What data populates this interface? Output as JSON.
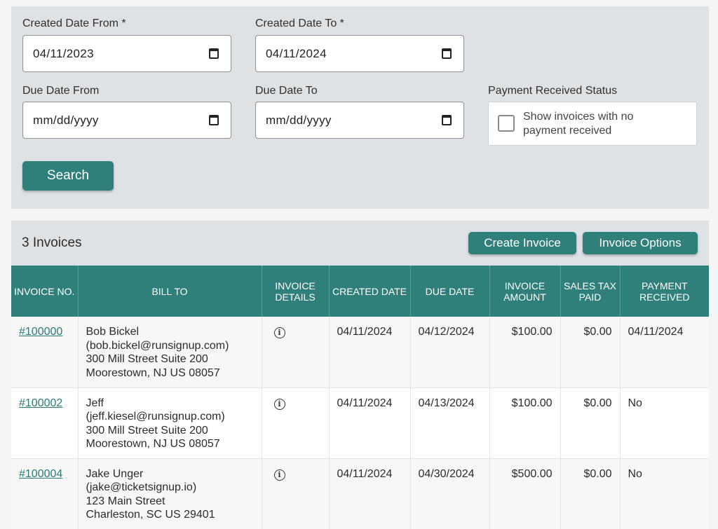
{
  "filters": {
    "created_from_label": "Created Date From *",
    "created_from_value": "04/11/2023",
    "created_to_label": "Created Date To *",
    "created_to_value": "04/11/2024",
    "due_from_label": "Due Date From",
    "due_from_value": "mm/dd/yyyy",
    "due_to_label": "Due Date To",
    "due_to_value": "mm/dd/yyyy",
    "payment_status_label": "Payment Received Status",
    "no_payment_checkbox_label": "Show invoices with no payment received",
    "no_payment_checked": false,
    "search_label": "Search"
  },
  "results": {
    "count_label": "3 Invoices",
    "create_invoice_label": "Create Invoice",
    "invoice_options_label": "Invoice Options",
    "columns": [
      "Invoice No.",
      "Bill To",
      "Invoice Details",
      "Created Date",
      "Due Date",
      "Invoice Amount",
      "Sales Tax Paid",
      "Payment Received"
    ],
    "rows": [
      {
        "invoice_no": "#100000",
        "bill_name": "Bob Bickel",
        "bill_email": "(bob.bickel@runsignup.com)",
        "bill_street": "300 Mill Street Suite 200",
        "bill_city": "Moorestown, NJ US 08057",
        "details_icon": "info-icon",
        "created": "04/11/2024",
        "due": "04/12/2024",
        "amount": "$100.00",
        "tax": "$0.00",
        "received": "04/11/2024"
      },
      {
        "invoice_no": "#100002",
        "bill_name": "Jeff",
        "bill_email": "(jeff.kiesel@runsignup.com)",
        "bill_street": "300 Mill Street Suite 200",
        "bill_city": "Moorestown, NJ US 08057",
        "details_icon": "info-icon",
        "created": "04/11/2024",
        "due": "04/13/2024",
        "amount": "$100.00",
        "tax": "$0.00",
        "received": "No"
      },
      {
        "invoice_no": "#100004",
        "bill_name": "Jake Unger",
        "bill_email": "(jake@ticketsignup.io)",
        "bill_street": "123 Main Street",
        "bill_city": "Charleston, SC US 29401",
        "details_icon": "info-icon",
        "created": "04/11/2024",
        "due": "04/30/2024",
        "amount": "$500.00",
        "tax": "$0.00",
        "received": "No"
      }
    ]
  },
  "colors": {
    "accent": "#2f7f7b",
    "panel_bg": "#dfe2e5"
  }
}
